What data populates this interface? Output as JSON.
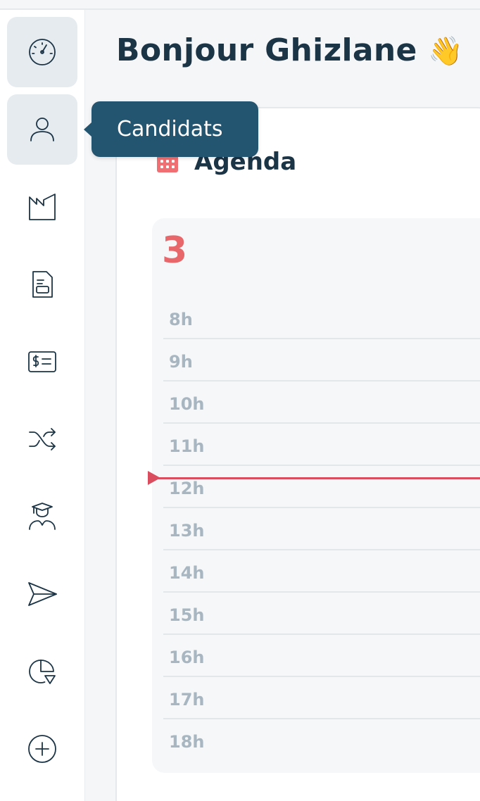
{
  "header": {
    "greeting": "Bonjour Ghizlane",
    "greeting_emoji": "👋"
  },
  "sidebar": {
    "items": [
      {
        "icon": "dashboard-icon",
        "active": true
      },
      {
        "icon": "user-icon",
        "active": true,
        "tooltip": "Candidats"
      },
      {
        "icon": "factory-icon",
        "active": false
      },
      {
        "icon": "document-icon",
        "active": false
      },
      {
        "icon": "invoice-icon",
        "active": false
      },
      {
        "icon": "shuffle-icon",
        "active": false
      },
      {
        "icon": "graduate-icon",
        "active": false
      },
      {
        "icon": "send-icon",
        "active": false
      },
      {
        "icon": "pie-chart-icon",
        "active": false
      },
      {
        "icon": "add-circle-icon",
        "active": false
      }
    ]
  },
  "tooltip": {
    "label": "Candidats"
  },
  "agenda": {
    "title": "Agenda",
    "day": "3",
    "hours": [
      "8h",
      "9h",
      "10h",
      "11h",
      "12h",
      "13h",
      "14h",
      "15h",
      "16h",
      "17h",
      "18h"
    ]
  },
  "colors": {
    "accent": "#e7676b",
    "now_line": "#d94d5e",
    "tooltip_bg": "#235470",
    "text_dark": "#1b3446",
    "hour_text": "#a7b6c1"
  }
}
